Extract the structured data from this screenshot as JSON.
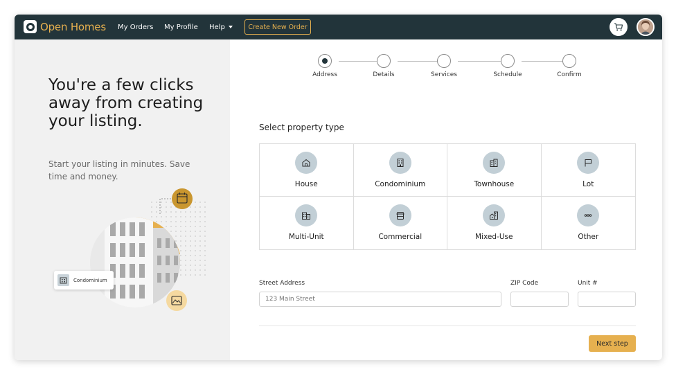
{
  "brand": {
    "name": "Open Homes"
  },
  "nav": {
    "orders": "My Orders",
    "profile": "My Profile",
    "help": "Help",
    "create": "Create New Order"
  },
  "left": {
    "headline": "You're a few clicks away from creating your listing.",
    "subtext": "Start your listing in minutes. Save time and money.",
    "badge": "Condominium"
  },
  "steps": [
    {
      "label": "Address",
      "active": true
    },
    {
      "label": "Details",
      "active": false
    },
    {
      "label": "Services",
      "active": false
    },
    {
      "label": "Schedule",
      "active": false
    },
    {
      "label": "Confirm",
      "active": false
    }
  ],
  "property": {
    "title": "Select property type",
    "types": [
      {
        "label": "House",
        "icon": "house-icon"
      },
      {
        "label": "Condominium",
        "icon": "condominium-icon"
      },
      {
        "label": "Townhouse",
        "icon": "townhouse-icon"
      },
      {
        "label": "Lot",
        "icon": "lot-flag-icon"
      },
      {
        "label": "Multi-Unit",
        "icon": "multi-unit-icon"
      },
      {
        "label": "Commercial",
        "icon": "commercial-store-icon"
      },
      {
        "label": "Mixed-Use",
        "icon": "mixed-use-icon"
      },
      {
        "label": "Other",
        "icon": "more-dots-icon"
      }
    ]
  },
  "form": {
    "street_label": "Street Address",
    "street_placeholder": "123 Main Street",
    "zip_label": "ZIP Code",
    "zip_placeholder": "",
    "unit_label": "Unit #",
    "unit_placeholder": ""
  },
  "actions": {
    "next": "Next step"
  },
  "colors": {
    "nav_bg": "#22343a",
    "accent": "#e6b04f",
    "icon_bg": "#c2cfd6"
  }
}
